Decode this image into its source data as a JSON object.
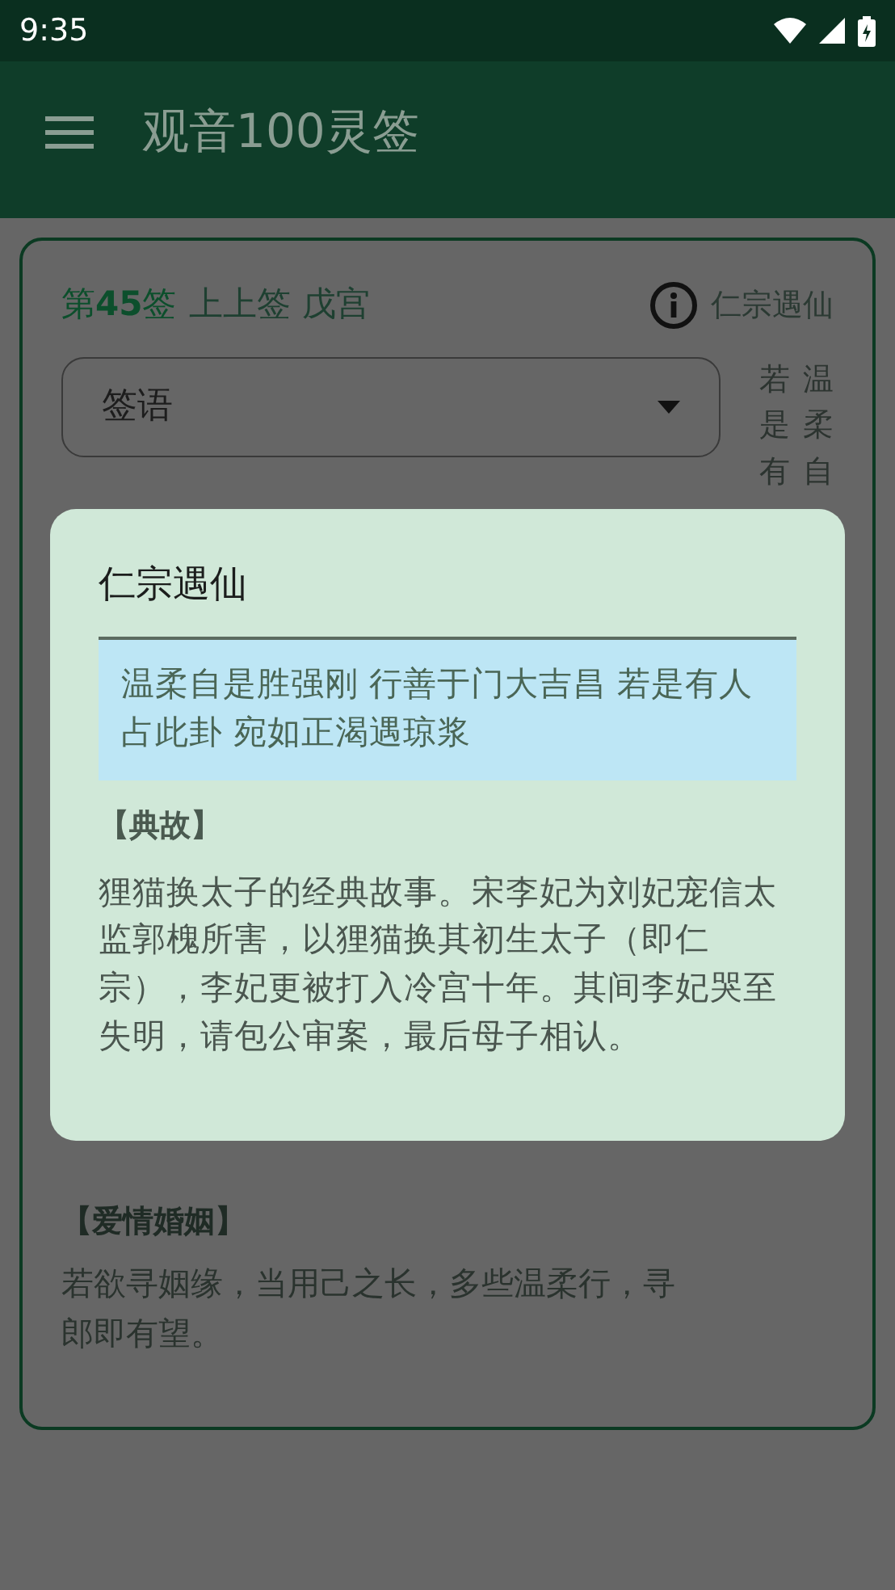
{
  "status_bar": {
    "time": "9:35"
  },
  "app_bar": {
    "title": "观音100灵签"
  },
  "card": {
    "lot_number": "第45签",
    "grade": "上上签",
    "palace": "戊宫",
    "story_link": "仁宗遇仙",
    "dropdown": {
      "value": "签语"
    },
    "poem_columns": [
      "若是有",
      "温柔自"
    ],
    "sections": [
      {
        "kind": "heading",
        "text": "【爱情婚姻】"
      },
      {
        "kind": "text",
        "text": "若欲寻姻缘，当用己之长，多些温柔行，寻郎即有望。"
      }
    ]
  },
  "dialog": {
    "title": "仁宗遇仙",
    "verse": "温柔自是胜强刚 行善于门大吉昌 若是有人占此卦 宛如正渴遇琼浆",
    "heading": "【典故】",
    "story": "狸猫换太子的经典故事。宋李妃为刘妃宠信太监郭槐所害，以狸猫换其初生太子（即仁宗），李妃更被打入冷宫十年。其间李妃哭至失明，请包公审案，最后母子相认。"
  }
}
